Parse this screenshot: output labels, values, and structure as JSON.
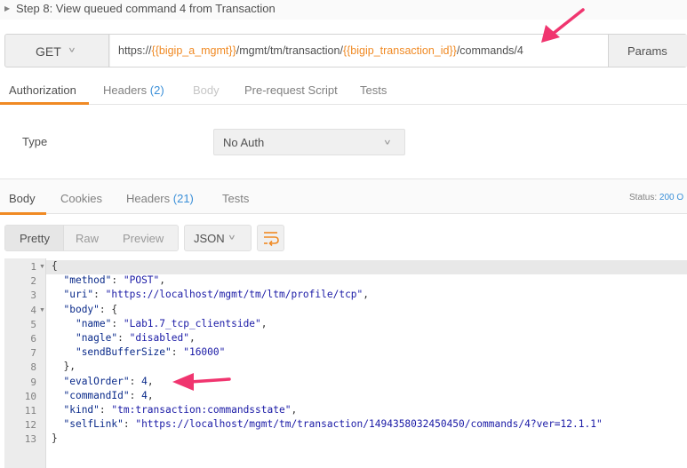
{
  "step": {
    "title": "Step 8: View queued command 4 from Transaction"
  },
  "request": {
    "method": "GET",
    "url_parts": [
      {
        "text": "https://",
        "var": false
      },
      {
        "text": "{{bigip_a_mgmt}}",
        "var": true
      },
      {
        "text": "/mgmt/tm/transaction/",
        "var": false
      },
      {
        "text": "{{bigip_transaction_id}}",
        "var": true
      },
      {
        "text": "/commands/4",
        "var": false
      }
    ],
    "params_label": "Params"
  },
  "request_tabs": {
    "authorization": "Authorization",
    "headers": "Headers",
    "headers_count": "(2)",
    "body": "Body",
    "prerequest": "Pre-request Script",
    "tests": "Tests"
  },
  "auth": {
    "type_label": "Type",
    "type_value": "No Auth"
  },
  "response_tabs": {
    "body": "Body",
    "cookies": "Cookies",
    "headers": "Headers",
    "headers_count": "(21)",
    "tests": "Tests",
    "status_label": "Status:",
    "status_value": "200 O"
  },
  "view": {
    "pretty": "Pretty",
    "raw": "Raw",
    "preview": "Preview",
    "format": "JSON"
  },
  "code": {
    "lines": [
      "{",
      "  \"method\": \"POST\",",
      "  \"uri\": \"https://localhost/mgmt/tm/ltm/profile/tcp\",",
      "  \"body\": {",
      "    \"name\": \"Lab1.7_tcp_clientside\",",
      "    \"nagle\": \"disabled\",",
      "    \"sendBufferSize\": \"16000\"",
      "  },",
      "  \"evalOrder\": 4,",
      "  \"commandId\": 4,",
      "  \"kind\": \"tm:transaction:commandsstate\",",
      "  \"selfLink\": \"https://localhost/mgmt/tm/transaction/1494358032450450/commands/4?ver=12.1.1\"",
      "}"
    ],
    "line_numbers": [
      "1",
      "2",
      "3",
      "4",
      "5",
      "6",
      "7",
      "8",
      "9",
      "10",
      "11",
      "12",
      "13"
    ],
    "foldable_lines": [
      1,
      4
    ]
  },
  "colors": {
    "accent_orange": "#f08a24",
    "count_blue": "#3a8fd8",
    "annotation_arrow": "#f0356f"
  }
}
